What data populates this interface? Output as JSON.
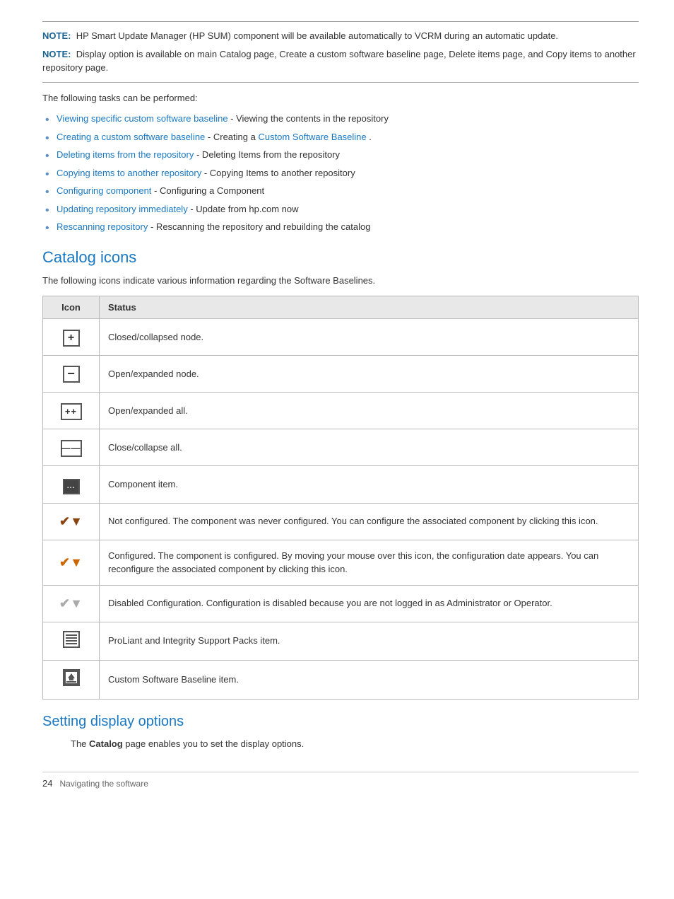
{
  "notes": [
    {
      "label": "NOTE:",
      "text": "HP Smart Update Manager (HP SUM) component will be available automatically to VCRM during an automatic update."
    },
    {
      "label": "NOTE:",
      "text": "Display option is available on main Catalog page, Create a custom software baseline page, Delete items page, and Copy items to another repository page."
    }
  ],
  "intro": "The following tasks can be performed:",
  "tasks": [
    {
      "link_text": "Viewing specific custom software baseline",
      "rest": " - Viewing the contents in the repository"
    },
    {
      "link_text": "Creating a custom software baseline",
      "rest": " - Creating a ",
      "link2_text": "Custom Software Baseline",
      "rest2": "."
    },
    {
      "link_text": "Deleting items from the repository",
      "rest": " - Deleting Items from the repository"
    },
    {
      "link_text": "Copying items to another repository",
      "rest": " - Copying Items to another repository"
    },
    {
      "link_text": "Configuring component",
      "rest": " - Configuring a Component"
    },
    {
      "link_text": "Updating repository immediately",
      "rest": " - Update from hp.com now"
    },
    {
      "link_text": "Rescanning repository",
      "rest": " - Rescanning the repository and rebuilding the catalog"
    }
  ],
  "catalog_section": {
    "title": "Catalog icons",
    "intro": "The following icons indicate various information regarding the Software Baselines.",
    "table": {
      "col_icon": "Icon",
      "col_status": "Status",
      "rows": [
        {
          "icon_type": "plus-box",
          "status": "Closed/collapsed node."
        },
        {
          "icon_type": "minus-box",
          "status": "Open/expanded node."
        },
        {
          "icon_type": "double-plus",
          "status": "Open/expanded all."
        },
        {
          "icon_type": "double-minus",
          "status": "Close/collapse all."
        },
        {
          "icon_type": "component",
          "status": "Component item."
        },
        {
          "icon_type": "wrench-brown",
          "status": "Not configured. The component was never configured. You can configure the associated component by clicking this icon."
        },
        {
          "icon_type": "wrench-orange",
          "status": "Configured. The component is configured. By moving your mouse over this icon, the configuration date appears. You can reconfigure the associated component by clicking this icon."
        },
        {
          "icon_type": "wrench-gray",
          "status": "Disabled Configuration. Configuration is disabled because you are not logged in as Administrator or Operator."
        },
        {
          "icon_type": "lines",
          "status": "ProLiant and Integrity Support Packs item."
        },
        {
          "icon_type": "upload",
          "status": "Custom Software Baseline item."
        }
      ]
    }
  },
  "setting_section": {
    "title": "Setting display options",
    "text_before": "The ",
    "bold_word": "Catalog",
    "text_after": " page enables you to set the display options."
  },
  "footer": {
    "page_number": "24",
    "text": "Navigating the software"
  }
}
